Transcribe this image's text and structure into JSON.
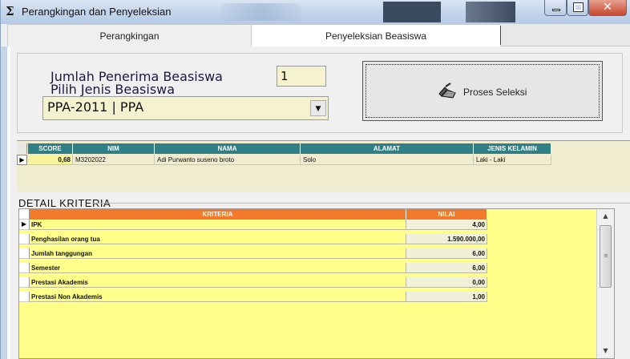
{
  "window": {
    "title_icon": "Σ",
    "title": "Perangkingan dan Penyeleksian",
    "controls": {
      "minimize": "",
      "maximize": "",
      "close": "✕"
    }
  },
  "tabs": [
    {
      "label": "Perangkingan"
    },
    {
      "label": "Penyeleksian Beasiswa"
    }
  ],
  "form": {
    "jumlah_label": "Jumlah Penerima Beasiswa",
    "pilih_label": "Pilih Jenis Beasiswa",
    "jumlah_value": "1",
    "jenis_value": "PPA-2011 | PPA",
    "combo_arrow": "▼",
    "proses_label": "Proses Seleksi",
    "proses_icon": "broom-icon"
  },
  "result_grid": {
    "columns": [
      "SCORE",
      "NIM",
      "NAMA",
      "ALAMAT",
      "JENIS KELAMIN"
    ],
    "rows": [
      {
        "score": "0,68",
        "nim": "M3202022",
        "nama": "Adi Purwanto suseno broto",
        "alamat": "Solo",
        "jenis_kelamin": "Laki - Laki"
      }
    ]
  },
  "detail": {
    "title": "DETAIL KRITERIA",
    "columns": [
      "KRITERIA",
      "NILAI"
    ],
    "rows": [
      {
        "kriteria": "IPK",
        "nilai": "4,00"
      },
      {
        "kriteria": "Penghasilan orang tua",
        "nilai": "1.590.000,00"
      },
      {
        "kriteria": "Jumlah tanggungan",
        "nilai": "6,00"
      },
      {
        "kriteria": "Semester",
        "nilai": "6,00"
      },
      {
        "kriteria": "Prestasi Akademis",
        "nilai": "0,00"
      },
      {
        "kriteria": "Prestasi Non Akademis",
        "nilai": "1,00"
      }
    ]
  },
  "colors": {
    "result_header": "#2f7f86",
    "detail_header": "#f47a2b",
    "grid_background": "#ffff8a",
    "input_background": "#f5f3cf"
  }
}
